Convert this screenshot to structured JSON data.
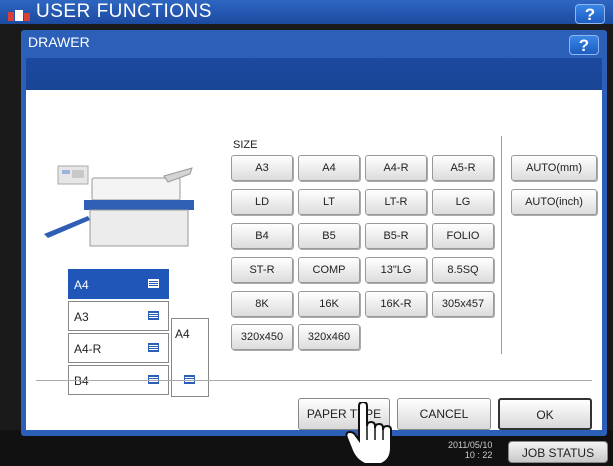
{
  "header": {
    "title": "USER FUNCTIONS",
    "help_label": "?"
  },
  "dialog": {
    "title": "DRAWER",
    "help_label": "?",
    "size_label": "SIZE",
    "size_buttons": [
      [
        "A3",
        "A4",
        "A4-R",
        "A5-R"
      ],
      [
        "LD",
        "LT",
        "LT-R",
        "LG"
      ],
      [
        "B4",
        "B5",
        "B5-R",
        "FOLIO"
      ],
      [
        "ST-R",
        "COMP",
        "13\"LG",
        "8.5SQ"
      ],
      [
        "8K",
        "16K",
        "16K-R",
        "305x457"
      ],
      [
        "320x450",
        "320x460"
      ]
    ],
    "auto_buttons": [
      "AUTO(mm)",
      "AUTO(inch)"
    ],
    "drawers": [
      {
        "label": "A4",
        "selected": true
      },
      {
        "label": "A3",
        "selected": false
      },
      {
        "label": "A4-R",
        "selected": false
      },
      {
        "label": "B4",
        "selected": false
      }
    ],
    "bypass_label": "A4",
    "actions": {
      "paper_type": "PAPER TYPE",
      "cancel": "CANCEL",
      "ok": "OK"
    }
  },
  "status": {
    "clock_date": "2011/05/10",
    "clock_time": "10 : 22",
    "job_status": "JOB STATUS"
  },
  "colors": {
    "header_blue": "#2c5fb8",
    "selected_drawer": "#1f56b8"
  }
}
